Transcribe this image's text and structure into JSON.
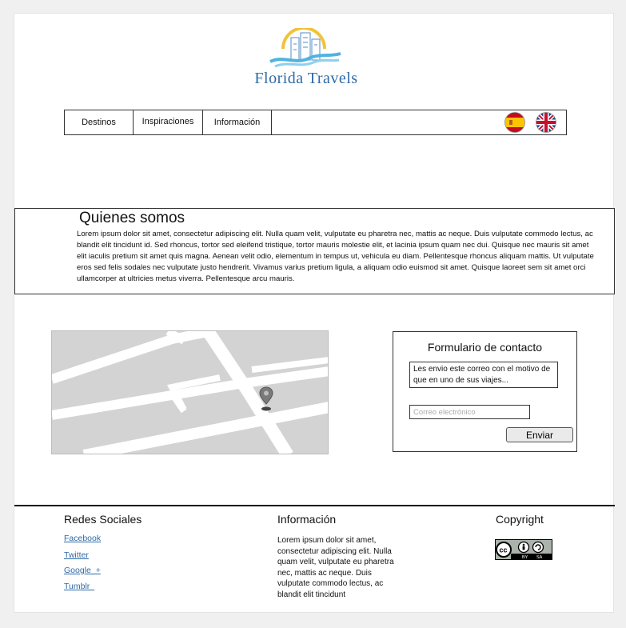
{
  "brand": {
    "name": "Florida Travels",
    "color": "#2f6aa6",
    "sun_color": "#f2c23a",
    "wave_color": "#4fb3e0"
  },
  "nav": {
    "items": [
      {
        "label": "Destinos"
      },
      {
        "label": "Inspiraciones"
      },
      {
        "label": "Información"
      }
    ],
    "language_flags": [
      {
        "icon": "spain-flag-icon"
      },
      {
        "icon": "uk-flag-icon"
      }
    ]
  },
  "about": {
    "title": "Quienes somos",
    "text": "Lorem ipsum dolor sit amet, consectetur adipiscing elit. Nulla quam velit, vulputate eu pharetra nec, mattis ac neque. Duis vulputate commodo lectus, ac blandit elit tincidunt id. Sed rhoncus, tortor sed eleifend tristique, tortor mauris molestie elit, et lacinia ipsum quam nec dui. Quisque nec mauris sit amet elit iaculis pretium sit amet quis magna. Aenean velit odio, elementum in tempus ut, vehicula eu diam. Pellentesque rhoncus aliquam mattis. Ut vulputate eros sed felis sodales nec vulputate justo hendrerit. Vivamus varius pretium ligula, a aliquam odio euismod sit amet. Quisque laoreet sem sit amet orci ullamcorper at ultricies metus viverra. Pellentesque arcu mauris."
  },
  "map": {
    "icon": "map-pin-icon",
    "background": "#d3d3d3"
  },
  "contact": {
    "title": "Formulario de contacto",
    "message_value": "Les envio este correo con el motivo de que en uno de sus viajes...",
    "email_placeholder": "Correo electrónico",
    "send_label": "Enviar"
  },
  "footer": {
    "social": {
      "heading": "Redes Sociales",
      "links": [
        {
          "label": "Facebook"
        },
        {
          "label": "Twitter"
        },
        {
          "label": "Google  +"
        },
        {
          "label": "Tumblr  "
        }
      ]
    },
    "info": {
      "heading": "Información",
      "text": "Lorem ipsum dolor sit amet, consectetur adipiscing elit. Nulla quam velit, vulputate eu pharetra nec, mattis ac neque. Duis vulputate commodo lectus, ac blandit elit tincidunt"
    },
    "copyright": {
      "heading": "Copyright",
      "badge": "cc-by-sa-icon"
    }
  }
}
